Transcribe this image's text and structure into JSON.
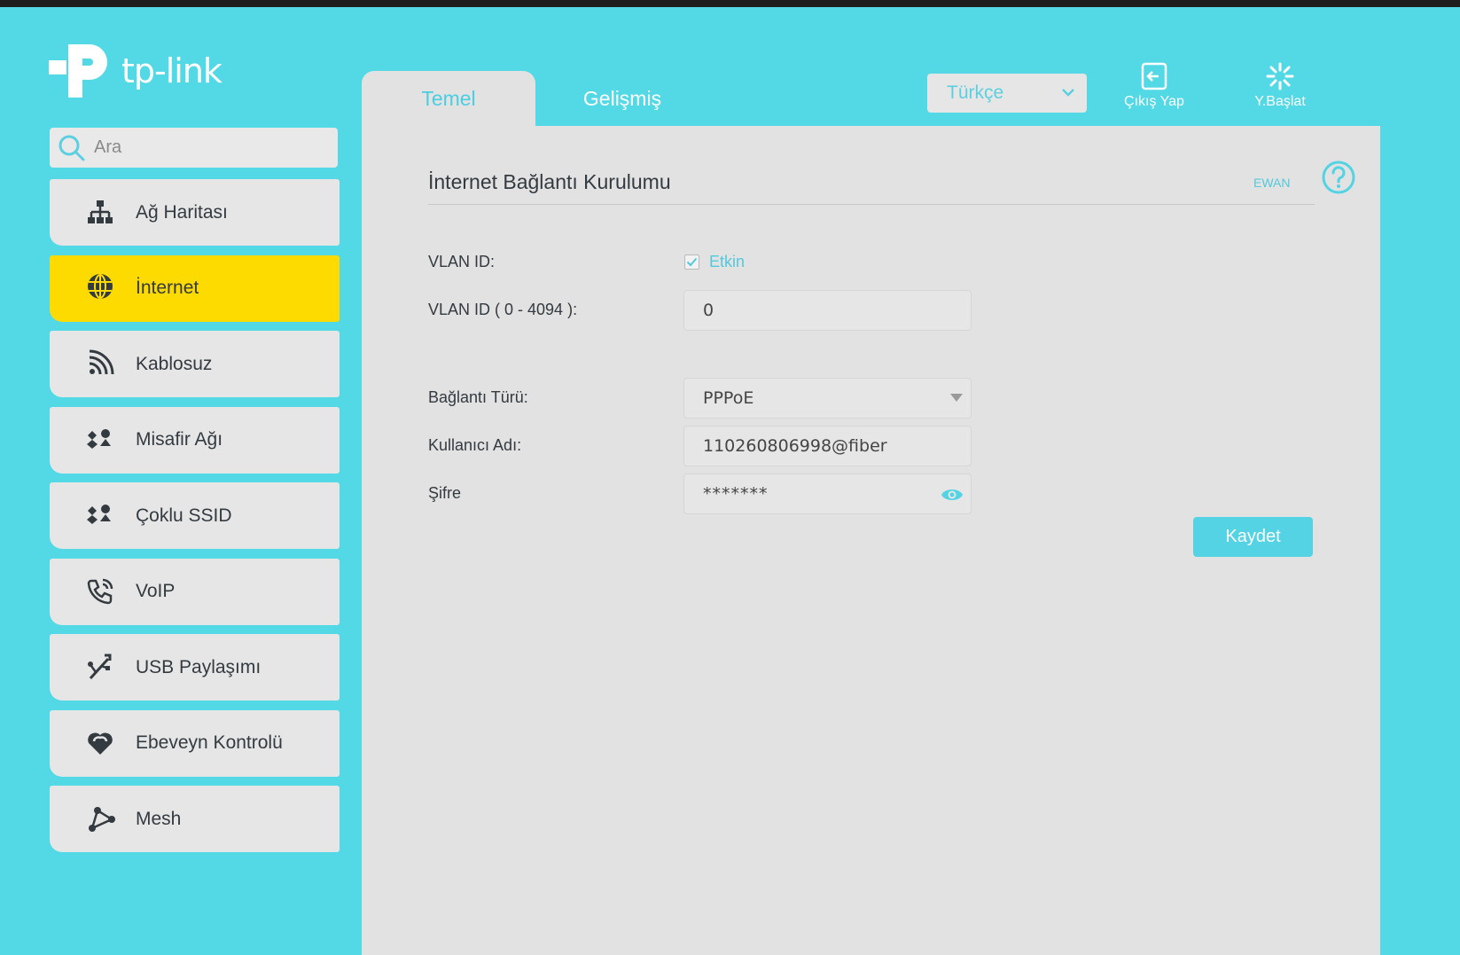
{
  "brand": {
    "name": "tp-link",
    "accent_color": "#53d9e5",
    "active_color": "#fedb00"
  },
  "search": {
    "placeholder": "Ara"
  },
  "sidebar": {
    "items": [
      {
        "label": "Ağ Haritası",
        "icon": "network-map-icon",
        "active": false
      },
      {
        "label": "İnternet",
        "icon": "globe-icon",
        "active": true
      },
      {
        "label": "Kablosuz",
        "icon": "wireless-icon",
        "active": false
      },
      {
        "label": "Misafir Ağı",
        "icon": "guest-network-icon",
        "active": false
      },
      {
        "label": "Çoklu SSID",
        "icon": "multi-ssid-icon",
        "active": false
      },
      {
        "label": "VoIP",
        "icon": "phone-icon",
        "active": false
      },
      {
        "label": "USB Paylaşımı",
        "icon": "usb-icon",
        "active": false
      },
      {
        "label": "Ebeveyn Kontrolü",
        "icon": "heart-icon",
        "active": false
      },
      {
        "label": "Mesh",
        "icon": "mesh-icon",
        "active": false
      }
    ]
  },
  "tabs": [
    {
      "label": "Temel",
      "active": true
    },
    {
      "label": "Gelişmiş",
      "active": false
    }
  ],
  "header": {
    "language": "Türkçe",
    "logout_label": "Çıkış Yap",
    "reboot_label": "Y.Başlat"
  },
  "main": {
    "title": "İnternet Bağlantı Kurulumu",
    "mode_label": "EWAN",
    "vlan_label": "VLAN ID:",
    "vlan_enabled_label": "Etkin",
    "vlan_enabled": true,
    "vlan_id_label": "VLAN ID ( 0 - 4094 ):",
    "vlan_id_value": "0",
    "connection_type_label": "Bağlantı Türü:",
    "connection_type_value": "PPPoE",
    "username_label": "Kullanıcı Adı:",
    "username_value": "110260806998@fiber",
    "password_label": "Şifre",
    "password_value": "*******",
    "save_label": "Kaydet"
  }
}
